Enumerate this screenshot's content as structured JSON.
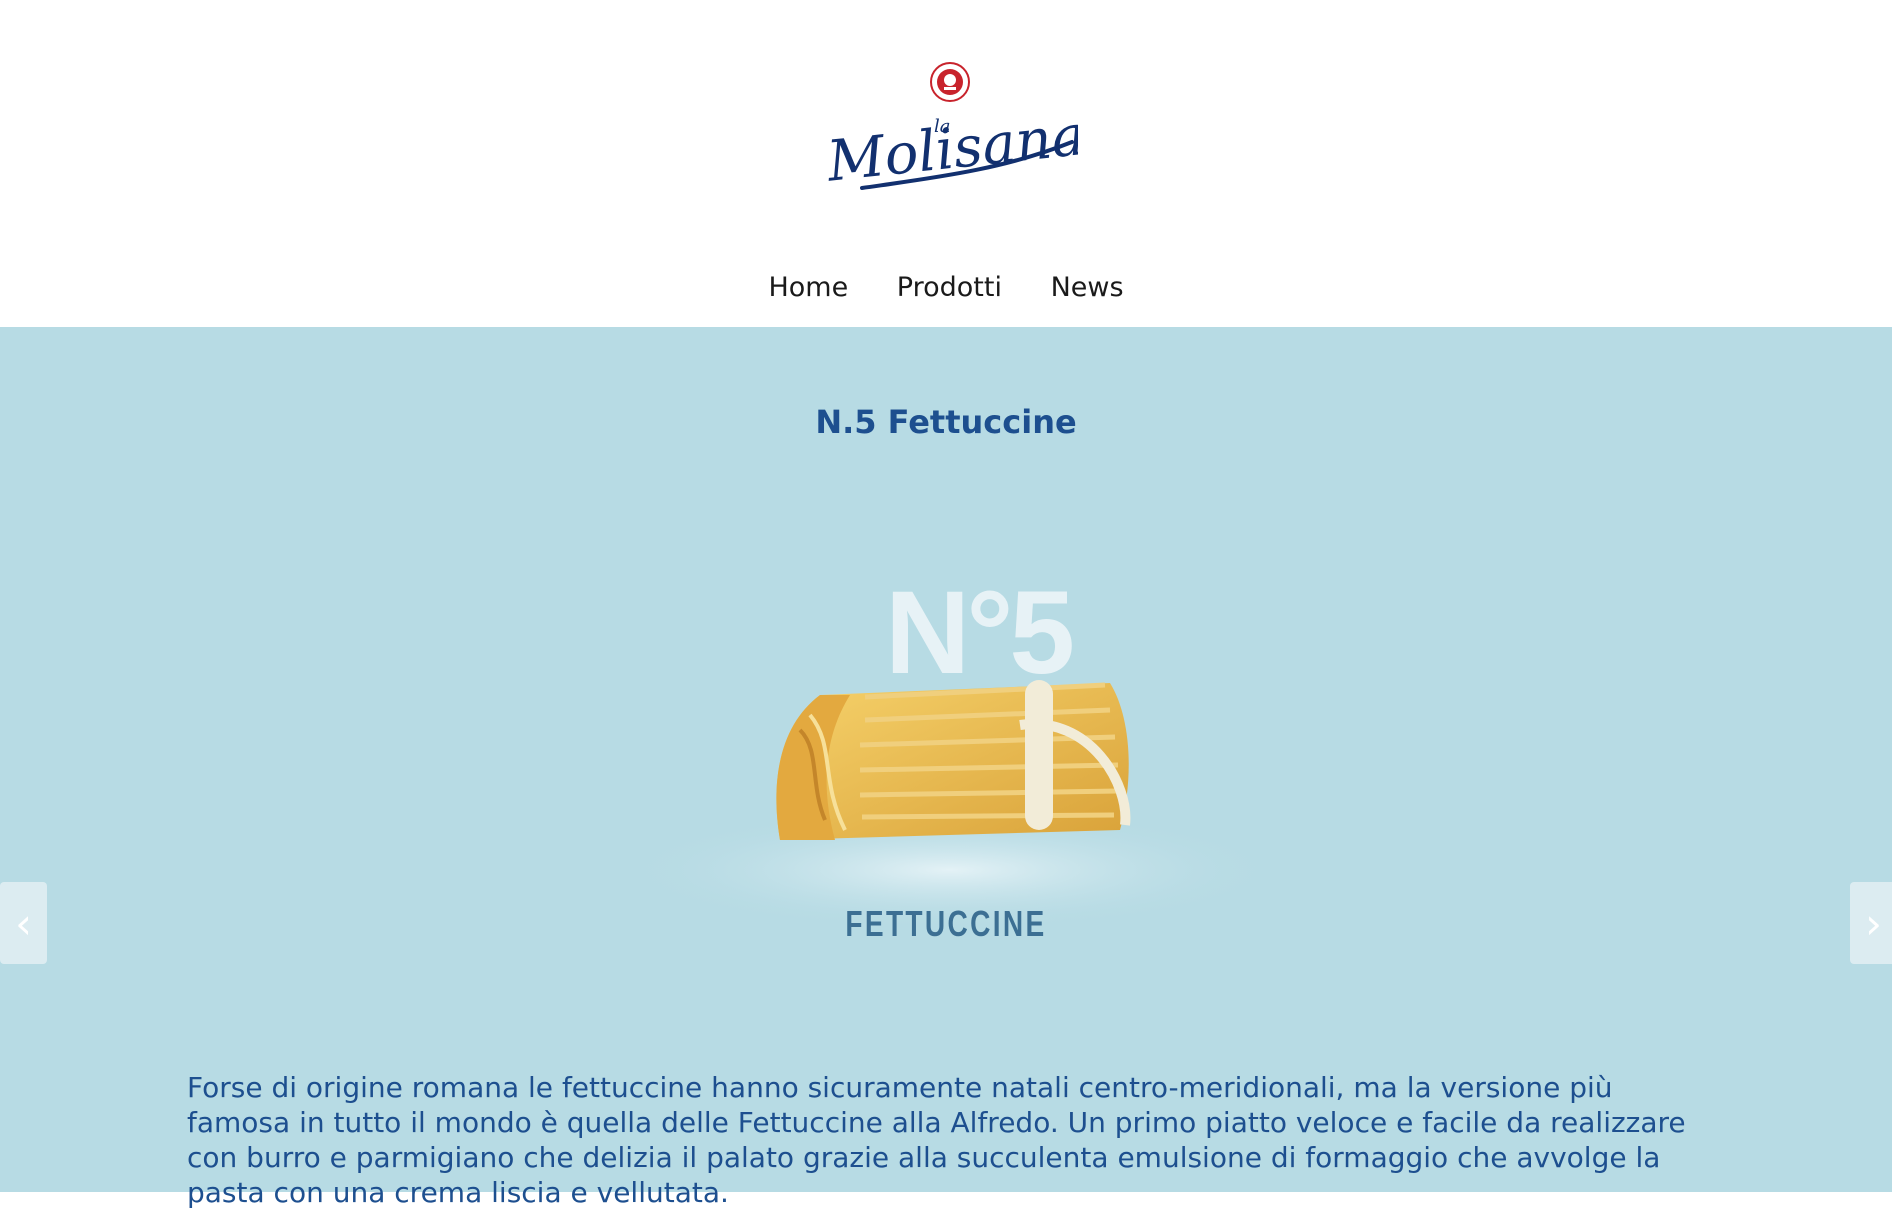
{
  "header": {
    "logo": {
      "wordmark": "Molisana",
      "wordmark_prefix": "la",
      "seal_icon": "la-molisana-seal-icon"
    },
    "nav": [
      {
        "label": "Home"
      },
      {
        "label": "Prodotti"
      },
      {
        "label": "News"
      }
    ]
  },
  "product": {
    "title": "N.5 Fettuccine",
    "image": {
      "number_mark": "N°5",
      "label": "FETTUCCINE"
    },
    "description": "Forse di origine romana le fettuccine hanno sicuramente natali centro-meridionali, ma la versione più famosa in tutto il mondo è quella delle Fettuccine alla Alfredo. Un primo piatto veloce e facile da realizzare con burro e parmigiano che delizia il palato grazie alla succulenta emulsione di formaggio che avvolge la pasta con una crema liscia e vellutata."
  },
  "carousel": {
    "prev_icon": "chevron-left-icon",
    "next_icon": "chevron-right-icon"
  },
  "colors": {
    "background": "#b7dbe4",
    "title": "#1d4f8f",
    "brand_navy": "#12306f",
    "seal_red": "#c8232c"
  }
}
